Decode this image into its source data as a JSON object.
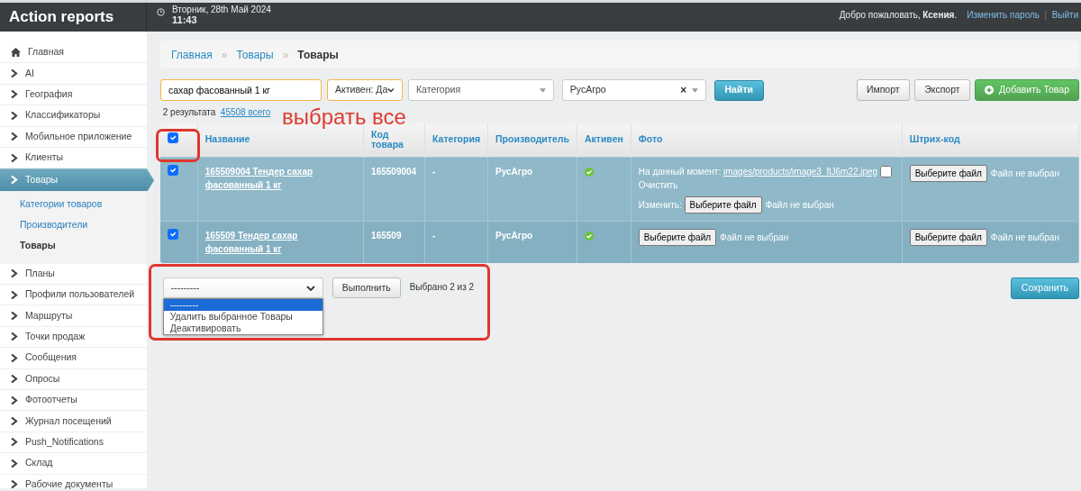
{
  "header": {
    "brand": "Action reports",
    "date": "Вторник, 28th Май 2024",
    "time": "11:43",
    "welcome": "Добро пожаловать, **Ксения**.",
    "links": [
      {
        "kind": "link",
        "label": "Изменить пароль"
      },
      {
        "kind": "sep",
        "label": "|"
      },
      {
        "kind": "link",
        "label": "Выйти"
      }
    ]
  },
  "sidebar": {
    "items": [
      {
        "label": "Главная",
        "kind": "home",
        "selected": false
      },
      {
        "label": "AI",
        "kind": "chevron",
        "selected": false
      },
      {
        "label": "География",
        "kind": "chevron",
        "selected": false
      },
      {
        "label": "Классификаторы",
        "kind": "chevron",
        "selected": false
      },
      {
        "label": "Мобильное приложение",
        "kind": "chevron",
        "selected": false
      },
      {
        "label": "Клиенты",
        "kind": "chevron",
        "selected": false
      },
      {
        "label": "Товары",
        "kind": "chevron",
        "selected": true,
        "children": [
          {
            "label": "Категории товаров",
            "selected": false
          },
          {
            "label": "Производители",
            "selected": false
          },
          {
            "label": "Товары",
            "selected": true
          }
        ]
      },
      {
        "label": "Планы",
        "kind": "chevron",
        "selected": false
      },
      {
        "label": "Профили пользователей",
        "kind": "chevron",
        "selected": false
      },
      {
        "label": "Маршруты",
        "kind": "chevron",
        "selected": false
      },
      {
        "label": "Точки продаж",
        "kind": "chevron",
        "selected": false
      },
      {
        "label": "Сообщения",
        "kind": "chevron",
        "selected": false
      },
      {
        "label": "Опросы",
        "kind": "chevron",
        "selected": false
      },
      {
        "label": "Фотоотчеты",
        "kind": "chevron",
        "selected": false
      },
      {
        "label": "Журнал посещений",
        "kind": "chevron",
        "selected": false
      },
      {
        "label": "Push_Notifications",
        "kind": "chevron",
        "selected": false
      },
      {
        "label": "Склад",
        "kind": "chevron",
        "selected": false
      },
      {
        "label": "Рабочие документы",
        "kind": "chevron",
        "selected": false
      }
    ]
  },
  "breadcrumb": {
    "items": [
      {
        "label": "Главная",
        "current": false
      },
      {
        "label": "Товары",
        "current": false
      },
      {
        "label": "Товары",
        "current": true
      }
    ],
    "separators": [
      "»",
      "»"
    ]
  },
  "filters": {
    "search": {
      "value": "сахар фасованный 1 кг"
    },
    "active": {
      "value": "Активен: Да"
    },
    "category": {
      "placeholder": "Категория"
    },
    "producer": {
      "value": "РусАгро",
      "clear": "×"
    },
    "find": "Найти"
  },
  "toolbar": [
    {
      "kind": "plain",
      "label": "Импорт"
    },
    {
      "kind": "plain",
      "label": "Экспорт"
    },
    {
      "kind": "add",
      "label": "Добавить Товар"
    }
  ],
  "results": {
    "count": "2 результата",
    "total": "45508 всего"
  },
  "table": {
    "select_all": {
      "checked": true
    },
    "columns": [
      "Название",
      "Код товара",
      "Категория",
      "Производитель",
      "Активен",
      "Фото",
      "Штрих-код"
    ],
    "rows": [
      {
        "selected": true,
        "checked": true,
        "name": "165509004 Тендер сахар фасованный 1 кг",
        "code": "165509004",
        "category": "-",
        "producer": "РусАгро",
        "active": true,
        "photo": {
          "current_label": "На данный момент:",
          "current_link": "images/products/image3_flJ6m22.jpeg",
          "clear_checked": false,
          "clear_label": "Очистить",
          "change_label": "Изменить:",
          "file_button": "Выберите файл",
          "file_status": "Файл не выбран"
        },
        "barcode": {
          "file_button": "Выберите файл",
          "file_status": "Файл не выбран"
        }
      },
      {
        "selected": true,
        "checked": true,
        "name": "165509 Тендер сахар фасованный 1 кг",
        "code": "165509",
        "category": "-",
        "producer": "РусАгро",
        "active": true,
        "photo": {
          "file_button": "Выберите файл",
          "file_status": "Файл не выбран"
        },
        "barcode": {
          "file_button": "Выберите файл",
          "file_status": "Файл не выбран"
        }
      }
    ]
  },
  "actions": {
    "select_value": "---------",
    "options": [
      {
        "label": "---------",
        "selected": true
      },
      {
        "label": "Удалить выбранное Товары",
        "selected": false
      },
      {
        "label": "Деактивировать",
        "selected": false
      }
    ],
    "run": "Выполнить",
    "status": "Выбрано 2 из 2",
    "save": "Сохранить"
  },
  "annotations": [
    {
      "kind": "label",
      "text": "выбрать все"
    },
    {
      "kind": "frame"
    },
    {
      "kind": "frame"
    }
  ]
}
